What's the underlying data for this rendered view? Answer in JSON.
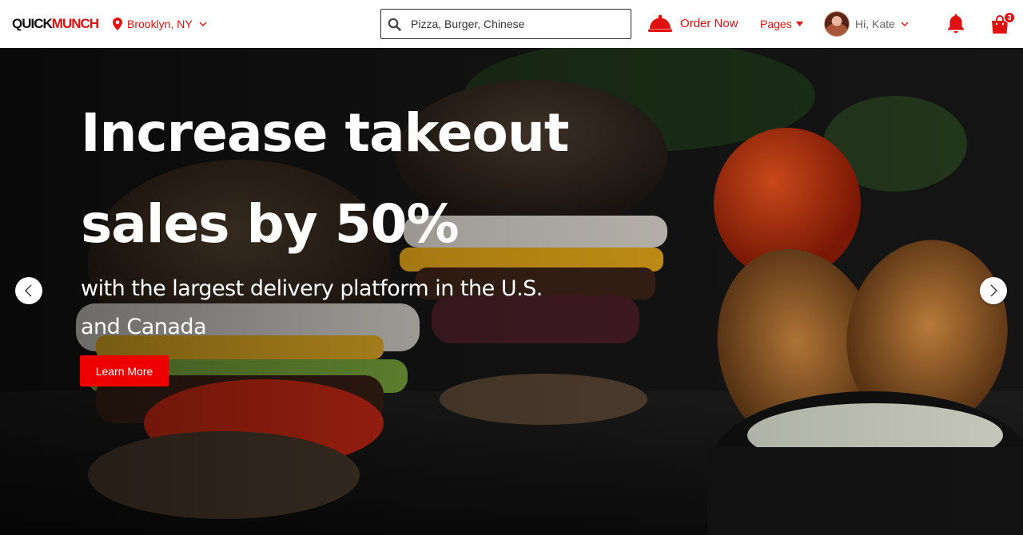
{
  "brand": {
    "logo_part1": "QUICK",
    "logo_part2": "MUNCH",
    "accent": "#e01010"
  },
  "location": {
    "label": "Brooklyn, NY",
    "icon": "map-pin-icon"
  },
  "search": {
    "placeholder": "Pizza, Burger, Chinese",
    "icon": "search-icon"
  },
  "nav": {
    "order_now": "Order Now",
    "pages": "Pages",
    "greeting": "Hi, Kate"
  },
  "cart": {
    "count": "3",
    "icon": "shopping-bag-icon"
  },
  "notifications": {
    "icon": "bell-icon"
  },
  "hero": {
    "title_line1": "Increase takeout",
    "title_line2": "sales by 50%",
    "subtitle_line1": "with the largest delivery platform in the U.S.",
    "subtitle_line2": "and Canada",
    "cta": "Learn More"
  }
}
